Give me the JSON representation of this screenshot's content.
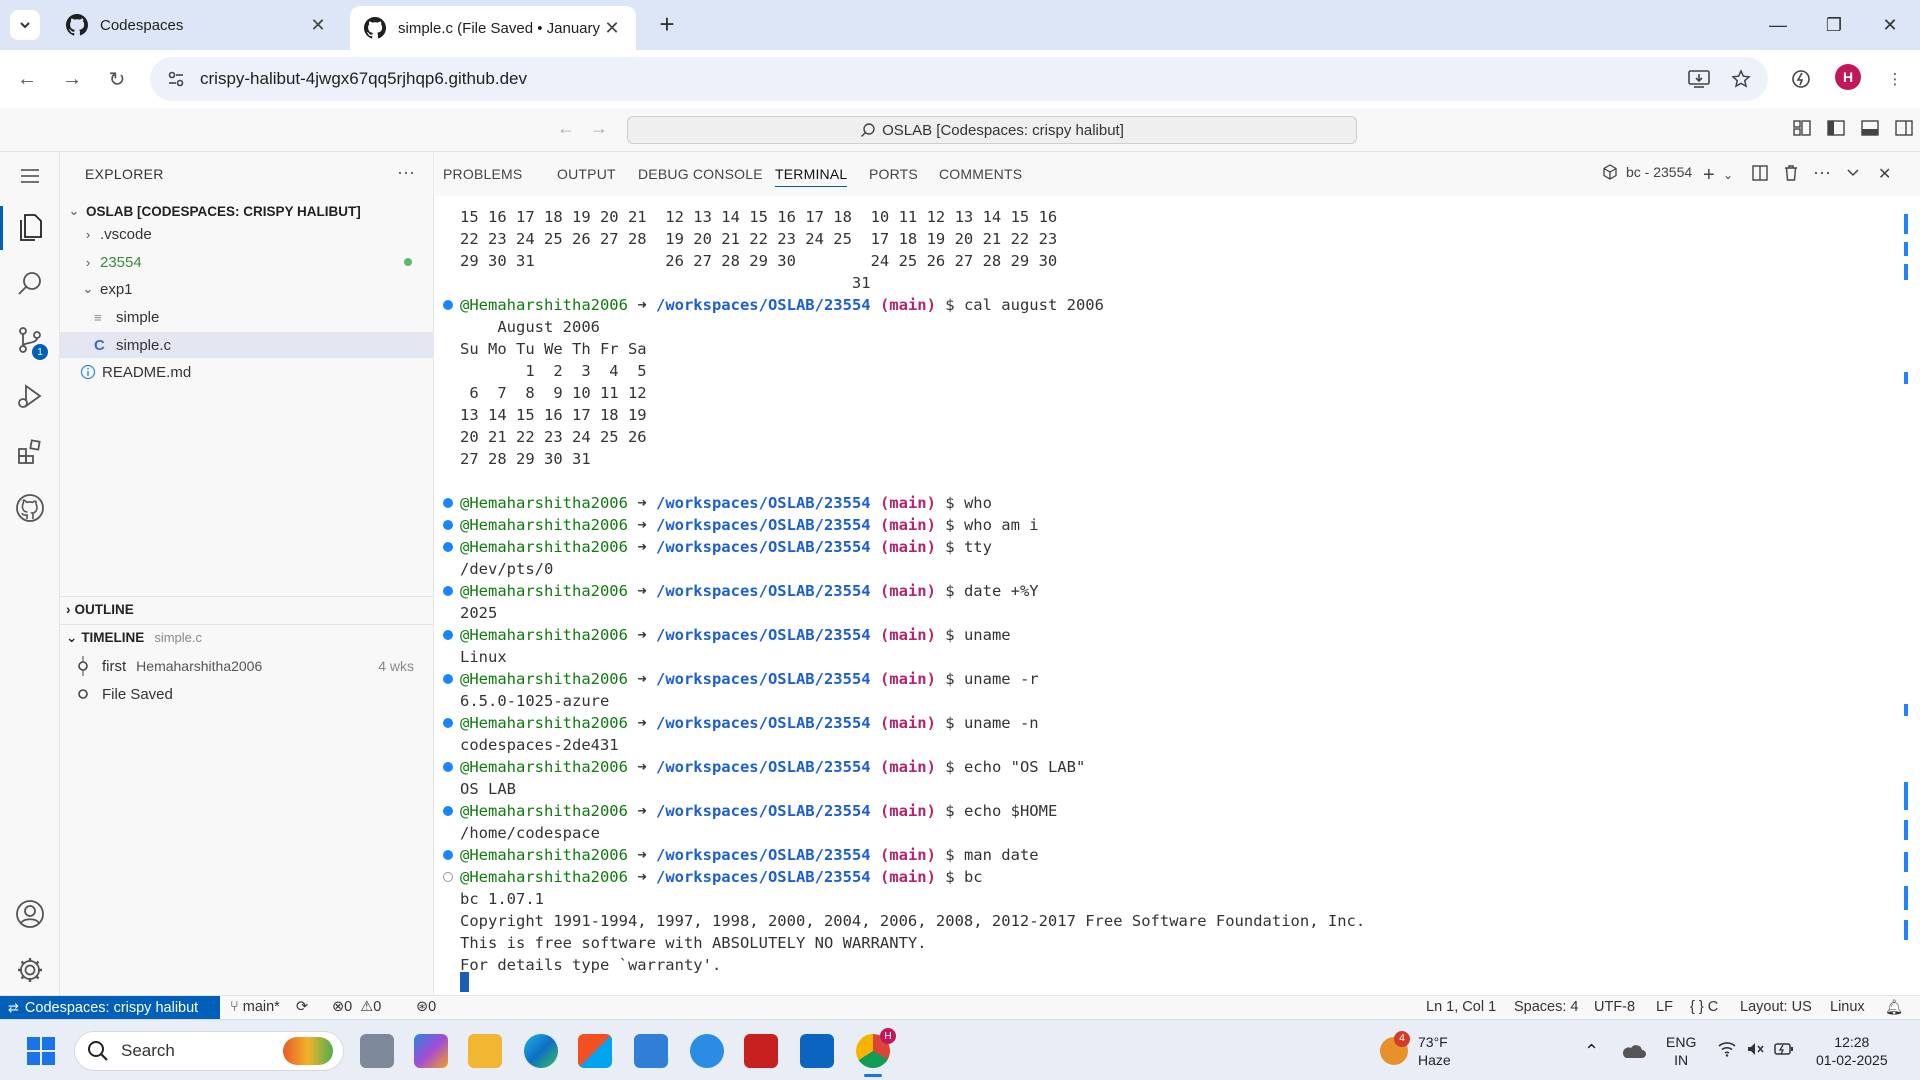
{
  "browser": {
    "tabs": [
      {
        "title": "Codespaces",
        "active": false
      },
      {
        "title": "simple.c (File Saved • January 2…",
        "active": true
      }
    ],
    "url": "crispy-halibut-4jwgx67qq5rjhqp6.github.dev",
    "profile_initial": "H"
  },
  "vscode": {
    "command_center": "OSLAB [Codespaces: crispy halibut]",
    "explorer": {
      "header": "EXPLORER",
      "root": "OSLAB [CODESPACES: CRISPY HALIBUT]",
      "items": [
        {
          "label": ".vscode",
          "kind": "folder",
          "depth": 1,
          "open": false
        },
        {
          "label": "23554",
          "kind": "folder",
          "depth": 1,
          "open": false,
          "modified": true
        },
        {
          "label": "exp1",
          "kind": "folder",
          "depth": 1,
          "open": true
        },
        {
          "label": "simple",
          "kind": "file",
          "depth": 2
        },
        {
          "label": "simple.c",
          "kind": "c",
          "depth": 2,
          "selected": true
        },
        {
          "label": "README.md",
          "kind": "info",
          "depth": 1
        }
      ]
    },
    "outline": {
      "label": "OUTLINE"
    },
    "timeline": {
      "label": "TIMELINE",
      "file": "simple.c",
      "entries": [
        {
          "title": "first",
          "author": "Hemaharshitha2006",
          "age": "4 wks"
        },
        {
          "title": "File Saved",
          "author": "",
          "age": ""
        }
      ]
    },
    "activity_badge": "1",
    "panel": {
      "tabs": [
        "PROBLEMS",
        "OUTPUT",
        "DEBUG CONSOLE",
        "TERMINAL",
        "PORTS",
        "COMMENTS"
      ],
      "active_tab": "TERMINAL",
      "terminal_name": "bc - 23554"
    },
    "terminal": {
      "user": "@Hemaharshitha2006",
      "path": "/workspaces/OSLAB/23554",
      "branch": "(main)",
      "lines": [
        {
          "t": "out",
          "text": "15 16 17 18 19 20 21  12 13 14 15 16 17 18  10 11 12 13 14 15 16"
        },
        {
          "t": "out",
          "text": "22 23 24 25 26 27 28  19 20 21 22 23 24 25  17 18 19 20 21 22 23"
        },
        {
          "t": "out",
          "text": "29 30 31              26 27 28 29 30        24 25 26 27 28 29 30"
        },
        {
          "t": "out",
          "text": "                                          31"
        },
        {
          "t": "cmd",
          "cmd": "cal august 2006"
        },
        {
          "t": "out",
          "text": "    August 2006"
        },
        {
          "t": "out",
          "text": "Su Mo Tu We Th Fr Sa"
        },
        {
          "t": "out",
          "text": "       1  2  3  4  5"
        },
        {
          "t": "out",
          "text": " 6  7  8  9 10 11 12"
        },
        {
          "t": "out",
          "text": "13 14 15 16 17 18 19"
        },
        {
          "t": "out",
          "text": "20 21 22 23 24 25 26"
        },
        {
          "t": "out",
          "text": "27 28 29 30 31"
        },
        {
          "t": "out",
          "text": ""
        },
        {
          "t": "cmd",
          "cmd": "who"
        },
        {
          "t": "cmd",
          "cmd": "who am i"
        },
        {
          "t": "cmd",
          "cmd": "tty"
        },
        {
          "t": "out",
          "text": "/dev/pts/0"
        },
        {
          "t": "cmd",
          "cmd": "date +%Y"
        },
        {
          "t": "out",
          "text": "2025"
        },
        {
          "t": "cmd",
          "cmd": "uname"
        },
        {
          "t": "out",
          "text": "Linux"
        },
        {
          "t": "cmd",
          "cmd": "uname -r"
        },
        {
          "t": "out",
          "text": "6.5.0-1025-azure"
        },
        {
          "t": "cmd",
          "cmd": "uname -n"
        },
        {
          "t": "out",
          "text": "codespaces-2de431"
        },
        {
          "t": "cmd",
          "cmd": "echo \"OS LAB\""
        },
        {
          "t": "out",
          "text": "OS LAB"
        },
        {
          "t": "cmd",
          "cmd": "echo $HOME"
        },
        {
          "t": "out",
          "text": "/home/codespace"
        },
        {
          "t": "cmd",
          "cmd": "man date"
        },
        {
          "t": "cmd",
          "cmd": "bc",
          "running": true
        },
        {
          "t": "out",
          "text": "bc 1.07.1"
        },
        {
          "t": "out",
          "text": "Copyright 1991-1994, 1997, 1998, 2000, 2004, 2006, 2008, 2012-2017 Free Software Foundation, Inc."
        },
        {
          "t": "out",
          "text": "This is free software with ABSOLUTELY NO WARRANTY."
        },
        {
          "t": "out",
          "text": "For details type `warranty'."
        }
      ]
    },
    "status": {
      "remote": "Codespaces: crispy halibut",
      "branch": "main*",
      "errors": "0",
      "warnings": "0",
      "ports": "0",
      "position": "Ln 1, Col 1",
      "spaces": "Spaces: 4",
      "encoding": "UTF-8",
      "eol": "LF",
      "language": "C",
      "layout": "Layout: US",
      "os": "Linux"
    }
  },
  "taskbar": {
    "search_placeholder": "Search",
    "weather_temp": "73°F",
    "weather_desc": "Haze",
    "weather_badge": "4",
    "lang_top": "ENG",
    "lang_bottom": "IN",
    "time": "12:28",
    "date": "01-02-2025",
    "chrome_badge": "H"
  },
  "colors": {
    "accent": "#005fb8",
    "prompt_user": "#0f7b0f",
    "prompt_path": "#1c5fd1",
    "prompt_branch": "#b8236f"
  }
}
